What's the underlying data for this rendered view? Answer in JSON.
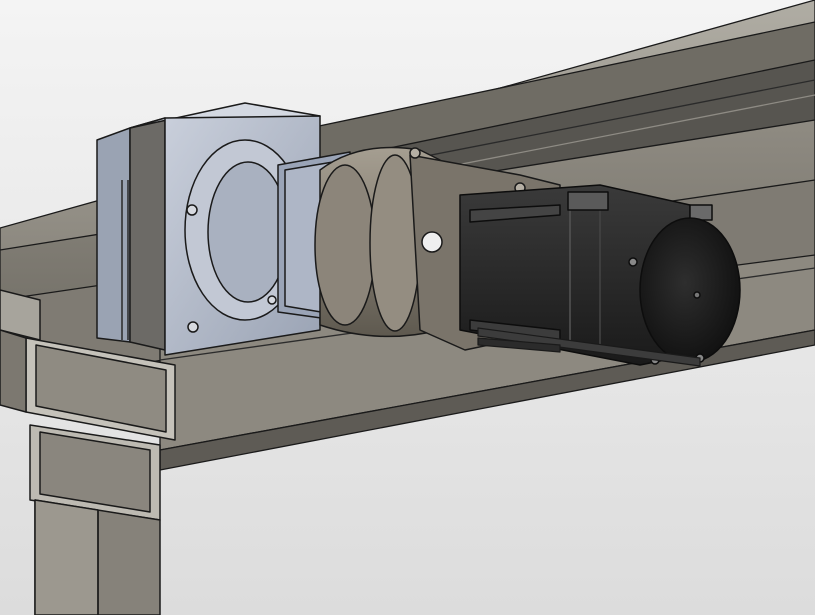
{
  "scene": {
    "subject": "cad-render",
    "colors": {
      "background_top": "#f4f4f4",
      "background_bottom": "#dcdcdc",
      "steel": "#7d7a72",
      "steel_light": "#a9a59b",
      "steel_dark": "#4d4b46",
      "plate_blue": "#b4bccb",
      "plate_blue_dark": "#8c95a6",
      "gearbox": "#8b8478",
      "gearbox_dark": "#5c574f",
      "motor": "#2b2b2b",
      "motor_dark": "#161616",
      "outline": "#1a1a1a"
    }
  }
}
